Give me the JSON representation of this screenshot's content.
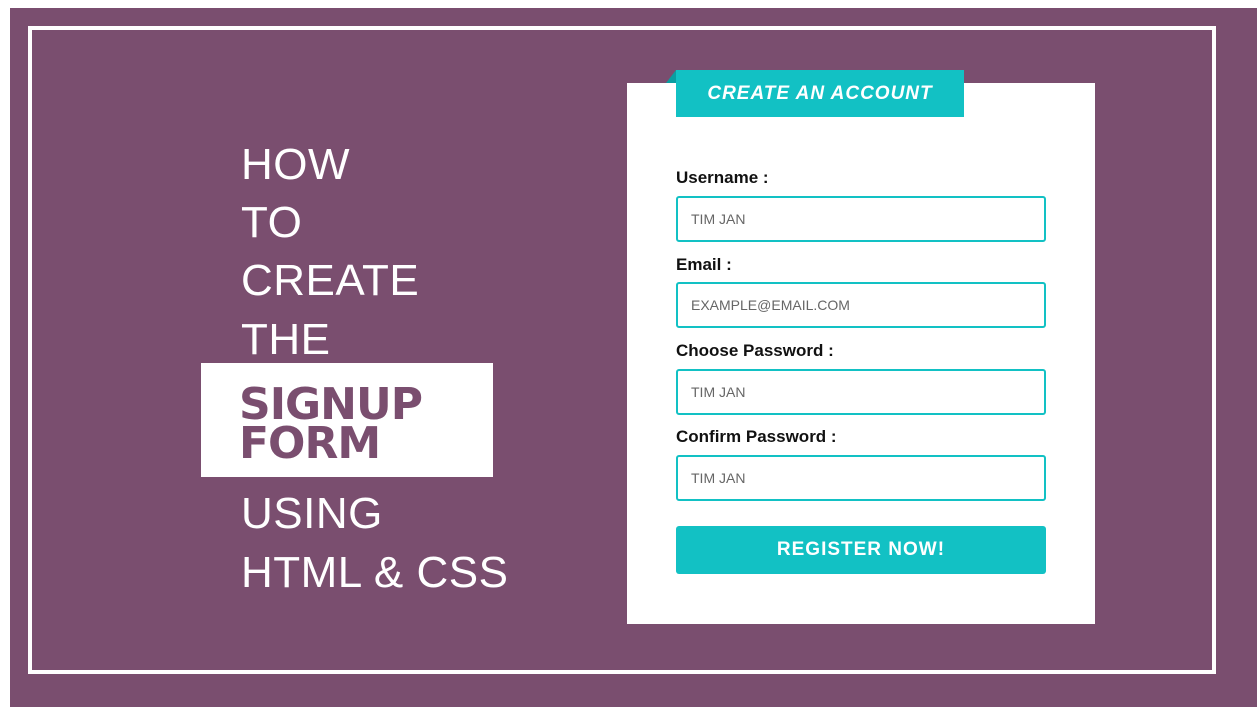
{
  "headline": {
    "line1": "HOW",
    "line2": "TO",
    "line3": "CREATE",
    "line4": "THE",
    "highlight_line1": "SIGNUP",
    "highlight_line2": "FORM",
    "line5": "USING",
    "line6": "HTML & CSS"
  },
  "form": {
    "title": "CREATE AN ACCOUNT",
    "fields": [
      {
        "label": "Username :",
        "placeholder": "TIM JAN"
      },
      {
        "label": "Email :",
        "placeholder": "EXAMPLE@EMAIL.COM"
      },
      {
        "label": "Choose Password :",
        "placeholder": "TIM JAN"
      },
      {
        "label": "Confirm Password :",
        "placeholder": "TIM JAN"
      }
    ],
    "submit_label": "REGISTER NOW!"
  },
  "colors": {
    "background": "#7a4e6f",
    "accent": "#12c1c4",
    "card": "#ffffff"
  }
}
